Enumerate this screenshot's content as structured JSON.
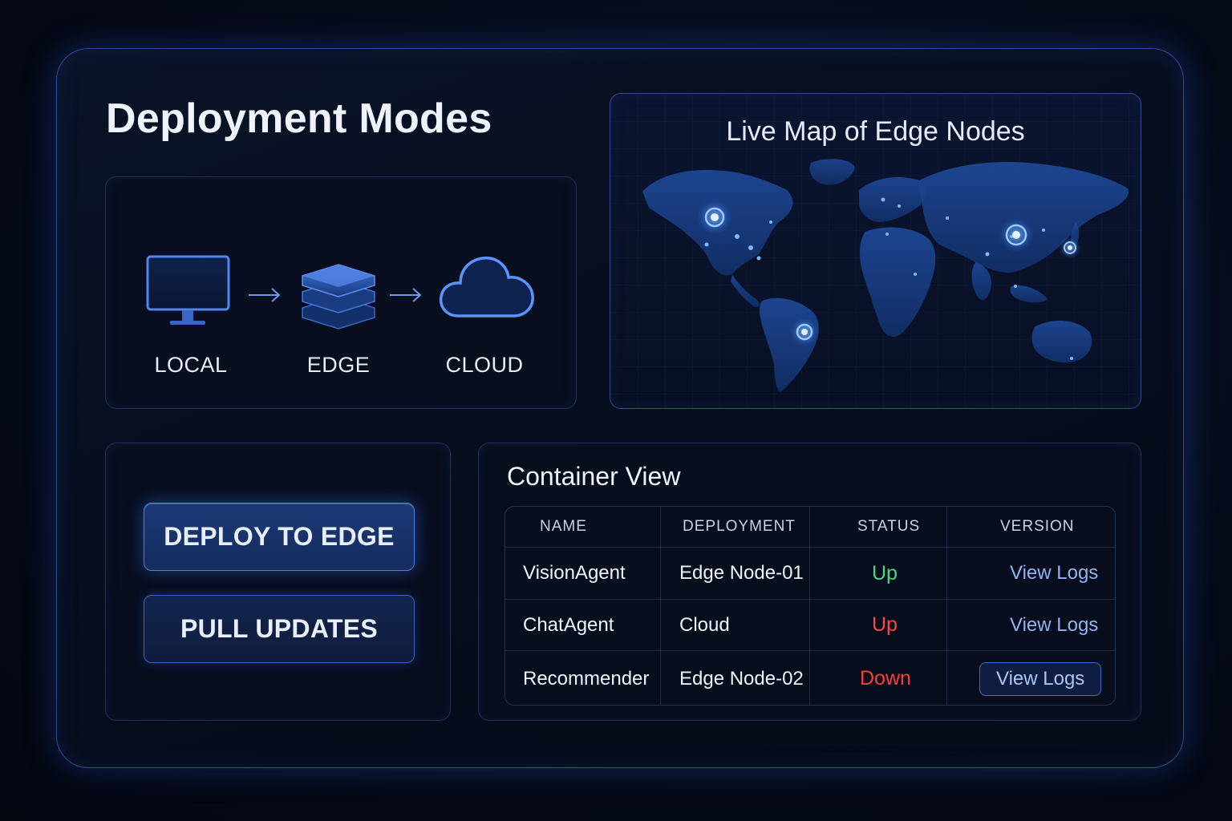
{
  "page": {
    "title": "Deployment Modes"
  },
  "modes": {
    "items": [
      {
        "label": "LOCAL",
        "icon": "monitor-icon"
      },
      {
        "label": "EDGE",
        "icon": "server-stack-icon"
      },
      {
        "label": "CLOUD",
        "icon": "cloud-icon"
      }
    ]
  },
  "map": {
    "title": "Live Map of Edge Nodes"
  },
  "actions": {
    "deploy_label": "DEPLOY TO EDGE",
    "pull_label": "PULL UPDATES"
  },
  "container_view": {
    "title": "Container View",
    "columns": [
      "NAME",
      "DEPLOYMENT",
      "STATUS",
      "VERSION"
    ],
    "rows": [
      {
        "name": "VisionAgent",
        "deployment": "Edge Node-01",
        "status": "Up",
        "status_color": "#3ddc84",
        "action": "View Logs"
      },
      {
        "name": "ChatAgent",
        "deployment": "Cloud",
        "status": "Up",
        "status_color": "#ff4545",
        "action": "View Logs"
      },
      {
        "name": "Recommender",
        "deployment": "Edge Node-02",
        "status": "Down",
        "status_color": "#ff3b3b",
        "action": "View Logs"
      }
    ]
  },
  "colors": {
    "accent": "#4d7fe8",
    "background": "#050a18"
  }
}
